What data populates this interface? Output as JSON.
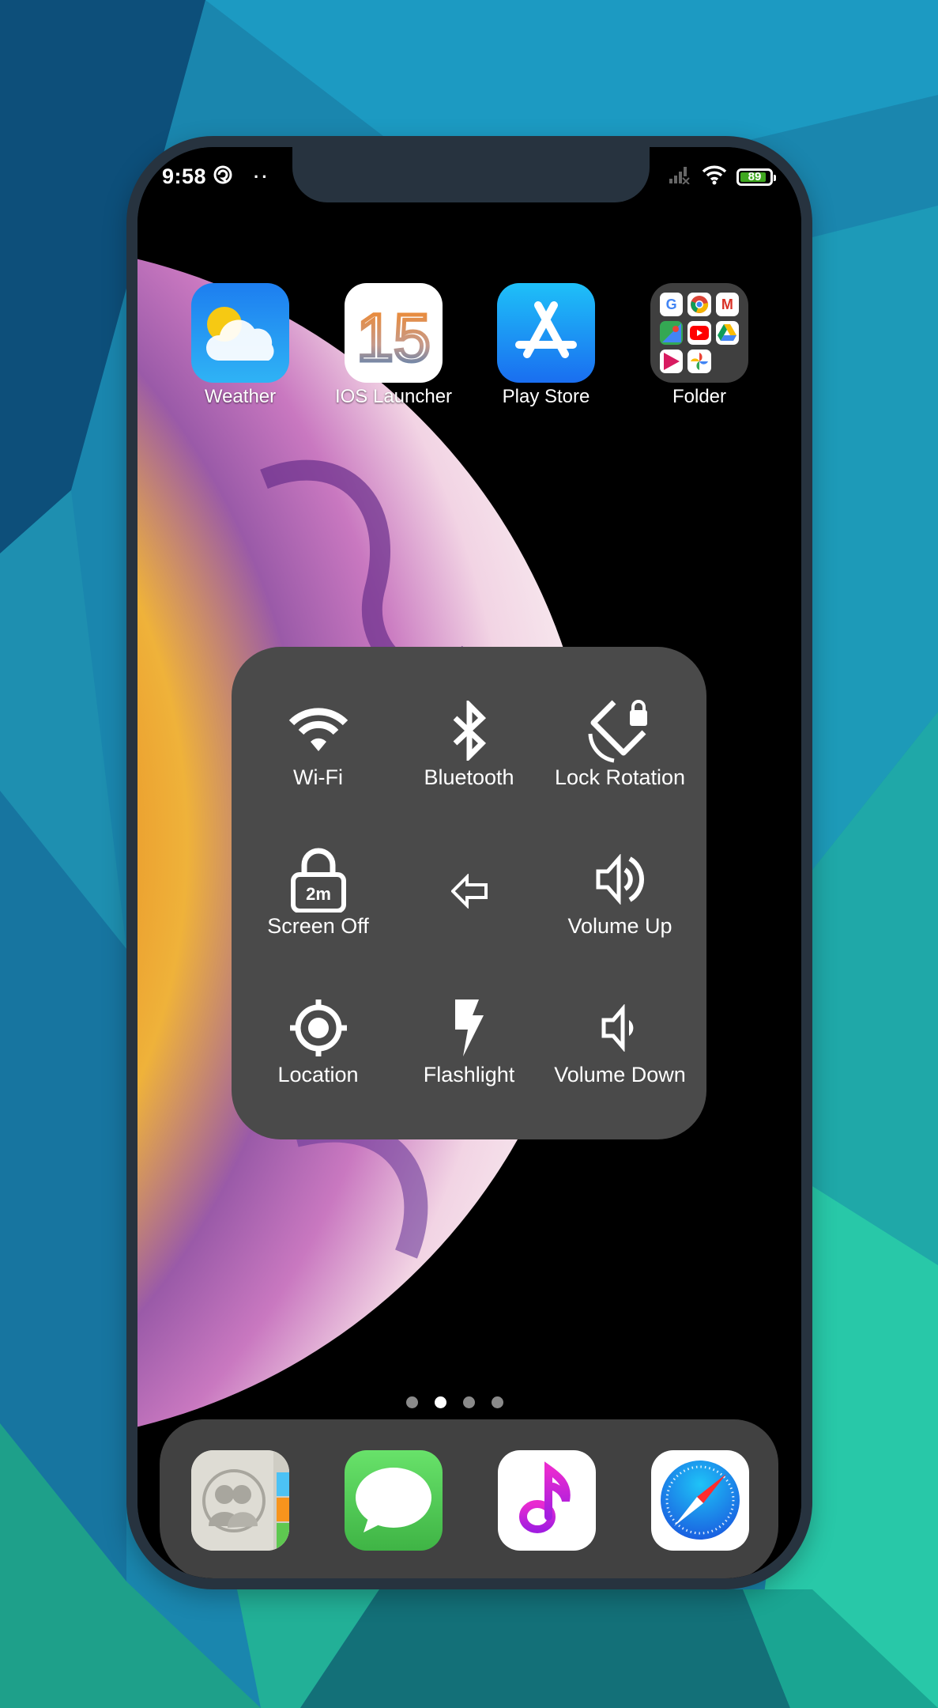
{
  "status_bar": {
    "time": "9:58",
    "notification_icons": [
      "at-sign-icon"
    ],
    "overflow_dots": "··",
    "battery_percent": 89,
    "battery_label": "89",
    "signal": "no-signal",
    "wifi": "connected"
  },
  "home_apps": [
    {
      "label": "Weather",
      "icon": "weather-icon"
    },
    {
      "label": "IOS Launcher",
      "icon": "ios15-icon",
      "icon_text": "15"
    },
    {
      "label": "Play Store",
      "icon": "app-store-icon"
    },
    {
      "label": "Folder",
      "icon": "folder-icon",
      "folder_items": [
        "Google",
        "Chrome",
        "Gmail",
        "Maps",
        "YouTube",
        "Drive",
        "Play Movies",
        "Photos"
      ]
    }
  ],
  "control_panel": {
    "tiles": [
      {
        "label": "Wi-Fi",
        "icon": "wifi-icon"
      },
      {
        "label": "Bluetooth",
        "icon": "bluetooth-icon"
      },
      {
        "label": "Lock Rotation",
        "icon": "rotation-lock-icon"
      },
      {
        "label": "Screen Off",
        "icon": "screen-off-lock-icon",
        "badge": "2m"
      },
      {
        "label": "",
        "icon": "back-arrow-icon"
      },
      {
        "label": "Volume Up",
        "icon": "volume-up-icon"
      },
      {
        "label": "Location",
        "icon": "location-icon"
      },
      {
        "label": "Flashlight",
        "icon": "flashlight-icon"
      },
      {
        "label": "Volume Down",
        "icon": "volume-down-icon"
      }
    ]
  },
  "page_indicator": {
    "pages": 4,
    "current": 2
  },
  "dock": [
    {
      "name": "Contacts",
      "icon": "contacts-icon"
    },
    {
      "name": "Messages",
      "icon": "messages-icon"
    },
    {
      "name": "Music",
      "icon": "music-icon"
    },
    {
      "name": "Safari",
      "icon": "safari-icon"
    }
  ],
  "colors": {
    "panel_bg": "#4a4a4a",
    "phone_frame": "#27333f",
    "battery_fill": "#3fa71f",
    "music_accent": "#c21fd8",
    "safari_blue": "#1a7ff0"
  }
}
